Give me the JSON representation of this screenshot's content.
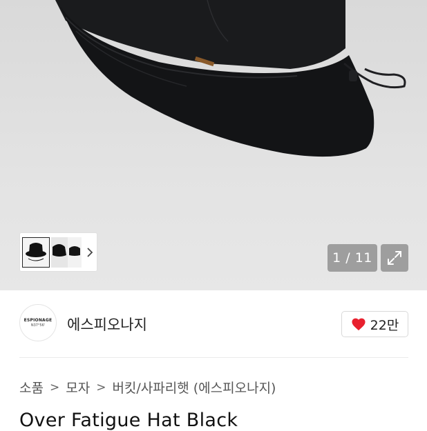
{
  "gallery": {
    "counter": "1 / 11",
    "current": 1,
    "total": 11
  },
  "icons": {
    "thumb_next": "chevron-right-icon",
    "expand": "expand-icon",
    "like": "heart-icon"
  },
  "brand": {
    "name": "에스피오나지",
    "logo_line1": "ESPIONAGE",
    "logo_line2": "N37°56'"
  },
  "like": {
    "count": "22만"
  },
  "breadcrumb": {
    "items": [
      "소품",
      "모자",
      "버킷/사파리햇 (에스피오나지)"
    ],
    "separator": ">"
  },
  "product": {
    "title": "Over Fatigue Hat Black"
  },
  "colors": {
    "heart": "#e8202e",
    "counter_bg": "#9e9e9e",
    "hero_bg": "#e3e3e3"
  }
}
